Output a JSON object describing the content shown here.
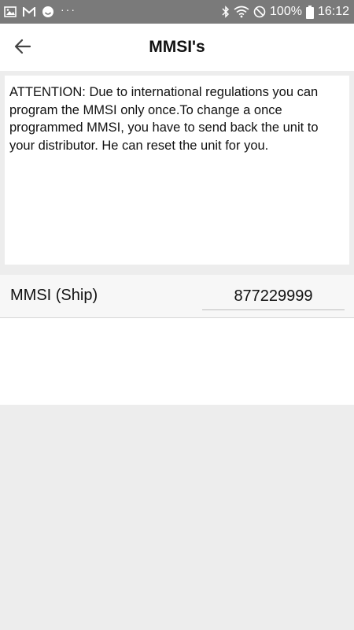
{
  "status_bar": {
    "battery": "100%",
    "time": "16:12",
    "more": "···",
    "icons_left": [
      "gallery-icon",
      "gmail-icon",
      "smiley-icon"
    ],
    "icons_right": [
      "bluetooth-icon",
      "wifi-icon",
      "do-not-disturb-icon",
      "battery-icon"
    ]
  },
  "app_bar": {
    "title": "MMSI's",
    "back_icon": "arrow-left-icon"
  },
  "notice": {
    "text": "ATTENTION: Due to international regulations you can program the MMSI only once.To change a once programmed MMSI, you have to send back the unit to your distributor. He can reset the unit for you."
  },
  "mmsi_row": {
    "label": "MMSI (Ship)",
    "value": "877229999"
  },
  "colors": {
    "status_bar": "#7a7a7a",
    "background": "#ededed",
    "surface": "#ffffff"
  }
}
